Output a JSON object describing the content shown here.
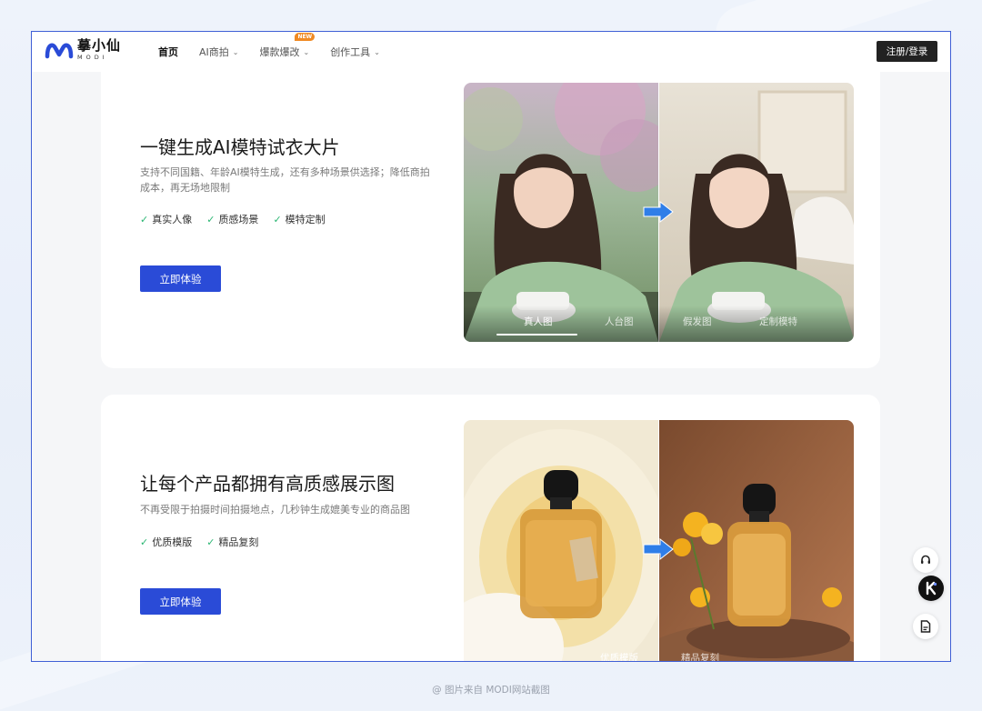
{
  "brand": {
    "name_cn": "摹小仙",
    "name_en": "MODI",
    "accent": "#2a4bd7"
  },
  "nav": {
    "items": [
      {
        "label": "首页",
        "active": true,
        "has_menu": false
      },
      {
        "label": "AI商拍",
        "active": false,
        "has_menu": true
      },
      {
        "label": "爆款爆改",
        "active": false,
        "has_menu": true,
        "badge": "NEW"
      },
      {
        "label": "创作工具",
        "active": false,
        "has_menu": true
      }
    ],
    "login_label": "注册/登录"
  },
  "sections": [
    {
      "title": "一键生成AI模特试衣大片",
      "description": "支持不同国籍、年龄AI模特生成，还有多种场景供选择；降低商拍成本，再无场地限制",
      "features": [
        "真实人像",
        "质感场景",
        "模特定制"
      ],
      "cta_label": "立即体验",
      "captions": [
        "真人图",
        "人台图",
        "假发图",
        "定制模特"
      ]
    },
    {
      "title": "让每个产品都拥有高质感展示图",
      "description": "不再受限于拍摄时间拍摄地点，几秒钟生成媲美专业的商品图",
      "features": [
        "优质模版",
        "精品复刻"
      ],
      "cta_label": "立即体验",
      "captions": [
        "优质模版",
        "精品复刻"
      ]
    }
  ],
  "floating": {
    "icons": [
      "headset-icon",
      "brand-k-icon",
      "document-icon"
    ]
  },
  "footer_note": "@ 图片来自 MODI网站截图"
}
